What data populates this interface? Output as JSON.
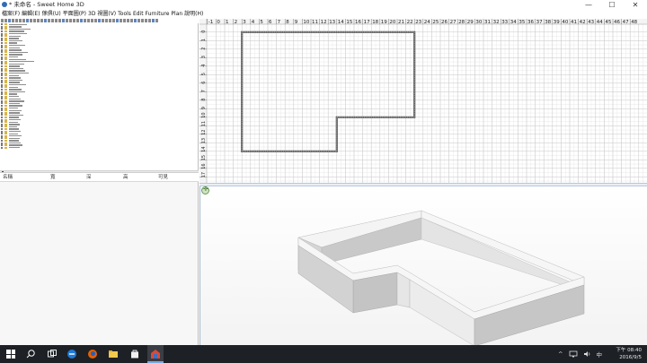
{
  "window": {
    "title": "* 未命名 - Sweet Home 3D",
    "controls": {
      "minimize": "—",
      "maximize": "☐",
      "close": "✕"
    }
  },
  "menubar": {
    "items": [
      "檔案(F)",
      "編輯(E)",
      "傢俱(U)",
      "平面圖(P)",
      "3D 視圖(V)",
      "Tools",
      "Edit Furniture",
      "Plan",
      "說明(H)"
    ]
  },
  "furniture_table": {
    "columns": [
      "名稱",
      "寬",
      "深",
      "高",
      "可見"
    ]
  },
  "plan": {
    "ruler_x_labels": [
      "-2",
      "-1",
      "0",
      "1",
      "2",
      "3",
      "4",
      "5",
      "6",
      "7",
      "8",
      "9",
      "10",
      "11",
      "12",
      "13",
      "14",
      "15",
      "16",
      "17",
      "18",
      "19",
      "20",
      "21",
      "22",
      "23",
      "24",
      "25",
      "26",
      "27",
      "28",
      "29",
      "30",
      "31",
      "32",
      "33",
      "34",
      "35",
      "36",
      "37",
      "38",
      "39",
      "40",
      "41",
      "42",
      "43",
      "44",
      "45",
      "46",
      "47",
      "48"
    ],
    "ruler_y_labels": [
      "-2",
      "-1",
      "0",
      "1",
      "2",
      "3",
      "4",
      "5",
      "6",
      "7",
      "8",
      "9",
      "10",
      "11",
      "12",
      "13",
      "14",
      "15",
      "16",
      "17"
    ],
    "walls": [
      [
        3,
        0
      ],
      [
        23,
        0
      ],
      [
        23,
        10
      ],
      [
        14,
        10
      ],
      [
        14,
        14
      ],
      [
        3,
        14
      ]
    ]
  },
  "taskbar": {
    "apps": [
      "start-icon",
      "search-icon",
      "task-view-icon",
      "edge-icon",
      "firefox-icon",
      "file-explorer-icon",
      "store-icon",
      "sweet-home-3d-icon"
    ],
    "tray": {
      "chevron": "^",
      "ime": "中",
      "time": "下午 08:40",
      "date": "2016/9/5"
    },
    "colors": {
      "background": "#1d2025"
    }
  }
}
